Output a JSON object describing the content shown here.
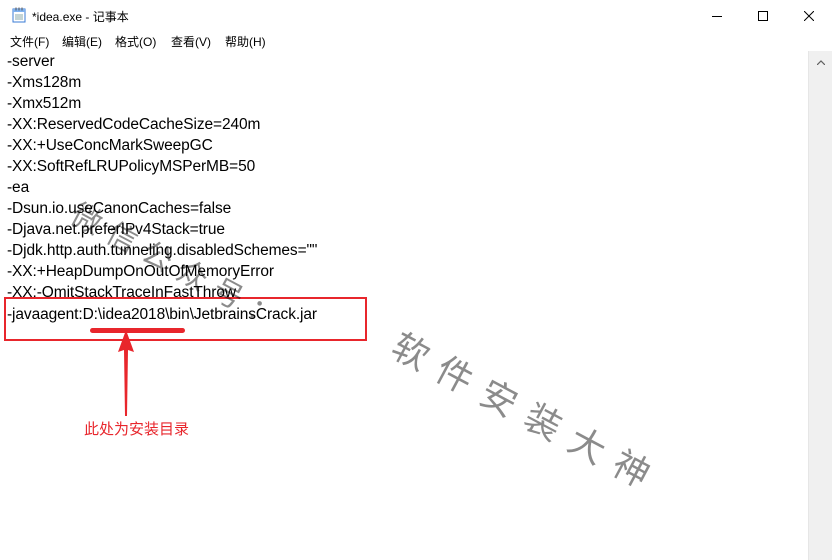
{
  "window": {
    "title": "*idea.exe - 记事本"
  },
  "menu": {
    "items": [
      {
        "label": "文件(F)"
      },
      {
        "label": "编辑(E)"
      },
      {
        "label": "格式(O)"
      },
      {
        "label": "查看(V)"
      },
      {
        "label": "帮助(H)"
      }
    ]
  },
  "editor": {
    "lines": [
      "-server",
      "-Xms128m",
      "-Xmx512m",
      "-XX:ReservedCodeCacheSize=240m",
      "-XX:+UseConcMarkSweepGC",
      "-XX:SoftRefLRUPolicyMSPerMB=50",
      "-ea",
      "-Dsun.io.useCanonCaches=false",
      "-Djava.net.preferIPv4Stack=true",
      "-Djdk.http.auth.tunneling.disabledSchemes=\"\"",
      "-XX:+HeapDumpOnOutOfMemoryError",
      "-XX:-OmitStackTraceInFastThrow",
      "-javaagent:D:\\idea2018\\bin\\JetbrainsCrack.jar"
    ]
  },
  "annotation": {
    "text": "此处为安装目录",
    "color": "#e8262c"
  },
  "watermark": {
    "part1": "微信公众号：",
    "part2": "软件安装大神"
  },
  "icons": {
    "app": "notepad-icon",
    "minimize": "minimize-icon",
    "maximize": "maximize-icon",
    "close": "close-icon",
    "scroll_up": "chevron-up-icon",
    "arrow": "arrow-up-icon"
  }
}
